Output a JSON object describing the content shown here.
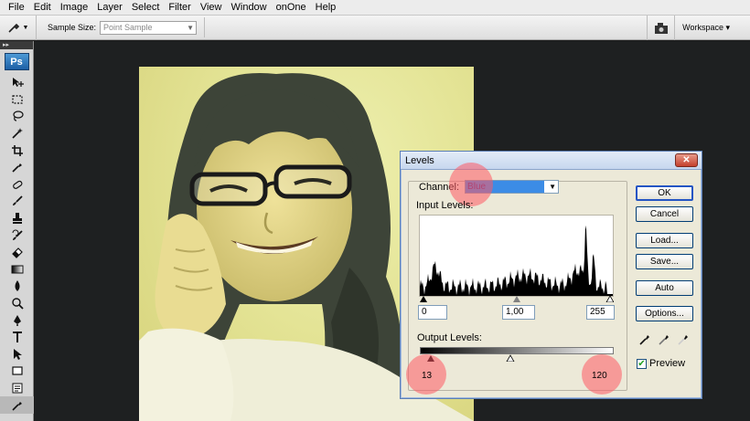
{
  "menu": [
    "File",
    "Edit",
    "Image",
    "Layer",
    "Select",
    "Filter",
    "View",
    "Window",
    "onOne",
    "Help"
  ],
  "options": {
    "sample_size_label": "Sample Size:",
    "sample_size_value": "Point Sample",
    "workspace_label": "Workspace ▾"
  },
  "toolbox": {
    "logo": "Ps",
    "grip": "▸▸",
    "tools": [
      "move-tool",
      "marquee-tool",
      "lasso-tool",
      "magic-wand-tool",
      "crop-tool",
      "eyedropper-tool",
      "healing-brush-tool",
      "brush-tool",
      "clone-stamp-tool",
      "history-brush-tool",
      "eraser-tool",
      "gradient-tool",
      "blur-tool",
      "dodge-tool",
      "pen-tool",
      "type-tool",
      "path-selection-tool",
      "shape-tool",
      "notes-tool",
      "eyedropper-active-tool"
    ]
  },
  "levels": {
    "title": "Levels",
    "close_glyph": "✕",
    "channel_label": "Channel:",
    "channel_value": "Blue",
    "input_levels_label": "Input Levels:",
    "input_black": "0",
    "input_gamma": "1,00",
    "input_white": "255",
    "output_levels_label": "Output Levels:",
    "output_black": "13",
    "output_white": "120",
    "buttons": {
      "ok": "OK",
      "cancel": "Cancel",
      "load": "Load...",
      "save": "Save...",
      "auto": "Auto",
      "options": "Options..."
    },
    "preview_label": "Preview",
    "preview_checked": true,
    "highlight_color": "#ff5a64"
  }
}
